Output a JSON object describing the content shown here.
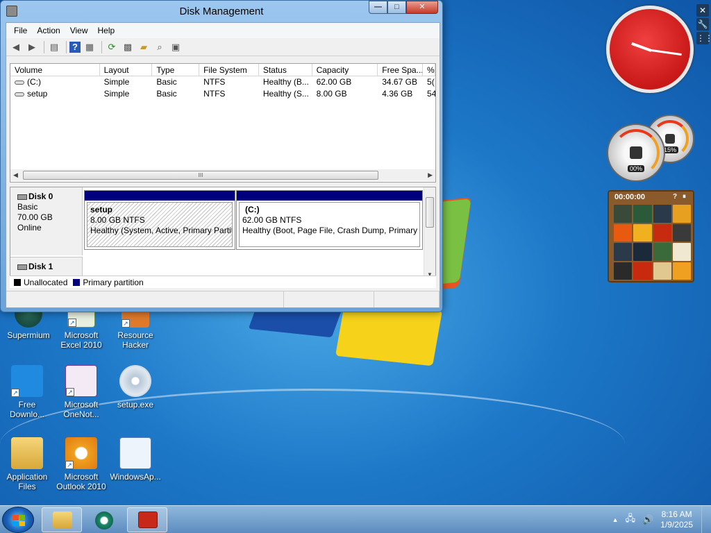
{
  "window": {
    "title": "Disk Management",
    "minimize_glyph": "—",
    "maximize_glyph": "□",
    "close_glyph": "✕"
  },
  "menu": [
    "File",
    "Action",
    "View",
    "Help"
  ],
  "toolbar_icons": [
    "back-arrow-icon",
    "forward-arrow-icon",
    "show-hide-tree-icon",
    "help-icon",
    "properties-icon",
    "refresh-icon",
    "export-icon",
    "open-icon",
    "search-icon",
    "settings-icon"
  ],
  "volumes": {
    "columns": [
      "Volume",
      "Layout",
      "Type",
      "File System",
      "Status",
      "Capacity",
      "Free Spa...",
      "%"
    ],
    "rows": [
      [
        "(C:)",
        "Simple",
        "Basic",
        "NTFS",
        "Healthy (B...",
        "62.00 GB",
        "34.67 GB",
        "5("
      ],
      [
        "setup",
        "Simple",
        "Basic",
        "NTFS",
        "Healthy (S...",
        "8.00 GB",
        "4.36 GB",
        "54"
      ]
    ],
    "scroll_thumb_label": "III"
  },
  "disks": [
    {
      "name": "Disk 0",
      "type": "Basic",
      "size": "70.00 GB",
      "state": "Online",
      "partitions": [
        {
          "name": "setup",
          "size_fs": "8.00 GB NTFS",
          "status": "Healthy (System, Active, Primary Partit"
        },
        {
          "name": "(C:)",
          "size_fs": "62.00 GB NTFS",
          "status": "Healthy (Boot, Page File, Crash Dump, Primary P"
        }
      ]
    },
    {
      "name": "Disk 1"
    }
  ],
  "legend": [
    {
      "label": "Unallocated",
      "color": "#000000"
    },
    {
      "label": "Primary partition",
      "color": "#00007e"
    }
  ],
  "desktop_icons": [
    {
      "label": "Supermium"
    },
    {
      "label": "Microsoft Excel 2010"
    },
    {
      "label": "Resource Hacker"
    },
    {
      "label": "Free Downlo..."
    },
    {
      "label": "Microsoft OneNot..."
    },
    {
      "label": "setup.exe"
    },
    {
      "label": "Application Files"
    },
    {
      "label": "Microsoft Outlook 2010"
    },
    {
      "label": "WindowsAp..."
    }
  ],
  "gadgets": {
    "cpu_pct": "00%",
    "mem_pct": "15%",
    "puzzle_timer": "00:00:00",
    "puzzle_help": "?",
    "puzzle_pause": "⏸"
  },
  "gadget_bar": {
    "close": "✕",
    "options": "🔧",
    "drag": "⋮⋮"
  },
  "taskbar": {
    "time": "8:16 AM",
    "date": "1/9/2025",
    "tray_up": "▲",
    "apps": [
      "windows-explorer",
      "supermium",
      "disk-management"
    ]
  },
  "colors": {
    "primary_partition": "#00007e",
    "title_bar": "#9cc6ee",
    "clock_face": "#c81818"
  }
}
